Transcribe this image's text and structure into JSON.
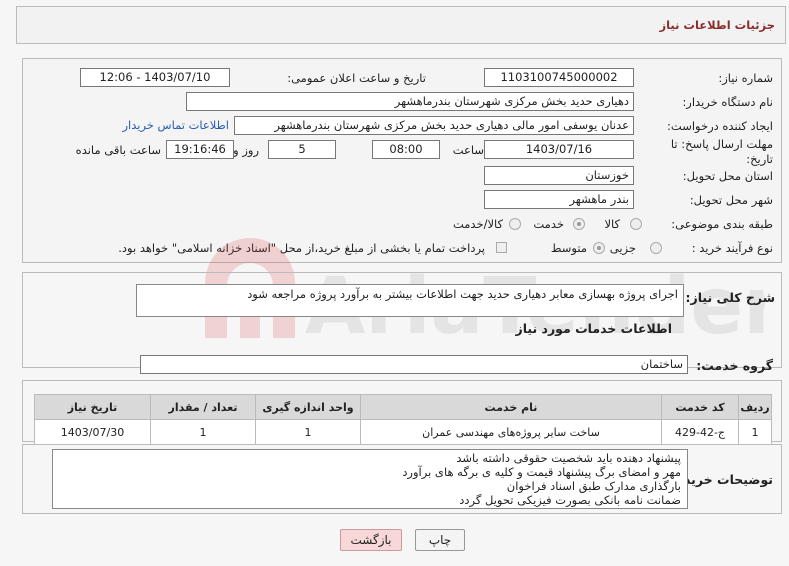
{
  "header": {
    "title": "جزئیات اطلاعات نیاز"
  },
  "form": {
    "need_number_label": "شماره نیاز:",
    "need_number": "1103100745000002",
    "announce_label": "تاریخ و ساعت اعلان عمومی:",
    "announce_value": "1403/07/10 - 12:06",
    "buyer_label": "نام دستگاه خریدار:",
    "buyer_value": "دهیاری حدید بخش مرکزی شهرستان بندرماهشهر",
    "creator_label": "ایجاد کننده درخواست:",
    "creator_value": "عدنان یوسفی امور مالی دهیاری حدید بخش مرکزی شهرستان بندرماهشهر",
    "contact_link": "اطلاعات تماس خریدار",
    "deadline_label": "مهلت ارسال پاسخ: تا تاریخ:",
    "deadline_date": "1403/07/16",
    "time_label": "ساعت",
    "deadline_time": "08:00",
    "days_value": "5",
    "days_label": "روز و",
    "remaining_time": "19:16:46",
    "remaining_label": "ساعت باقی مانده",
    "province_label": "استان محل تحویل:",
    "province_value": "خوزستان",
    "city_label": "شهر محل تحویل:",
    "city_value": "بندر ماهشهر",
    "category_label": "طبقه بندی موضوعی:",
    "category_options": [
      "کالا",
      "خدمت",
      "کالا/خدمت"
    ],
    "process_label": "نوع فرآیند خرید :",
    "process_options": [
      "جزیی",
      "متوسط"
    ],
    "payment_note": "پرداخت تمام یا بخشی از مبلغ خرید،از محل \"اسناد خزانه اسلامی\" خواهد بود."
  },
  "summary": {
    "label": "شرح کلی نیاز:",
    "text": "اجرای پروژه بهسازی معابر دهیاری حدید جهت اطلاعات بیشتر به برآورد پروژه مراجعه شود"
  },
  "services": {
    "section_title": "اطلاعات خدمات مورد نیاز",
    "group_label": "گروه خدمت:",
    "group_value": "ساختمان",
    "columns": [
      "ردیف",
      "کد خدمت",
      "نام خدمت",
      "واحد اندازه گیری",
      "تعداد / مقدار",
      "تاریخ نیاز"
    ],
    "rows": [
      [
        "1",
        "ج-42-429",
        "ساخت سایر پروژه‌های مهندسی عمران",
        "1",
        "1",
        "1403/07/30"
      ]
    ]
  },
  "buyer_notes": {
    "label": "توضیحات خریدار:",
    "lines": [
      "پیشنهاد دهنده باید شخصیت حقوقی داشته باشد",
      "مهر و امضای برگ پیشنهاد قیمت و کلیه ی برگه های برآورد",
      "بارگذاری مدارک طبق اسناد فراخوان",
      "ضمانت نامه بانکی بصورت فیزیکی تحویل گردد"
    ]
  },
  "buttons": {
    "print": "چاپ",
    "back": "بازگشت"
  },
  "colors": {
    "header_text": "#8b2d2d",
    "back_button_bg": "#f7d7d7",
    "link": "#2a5db0"
  }
}
